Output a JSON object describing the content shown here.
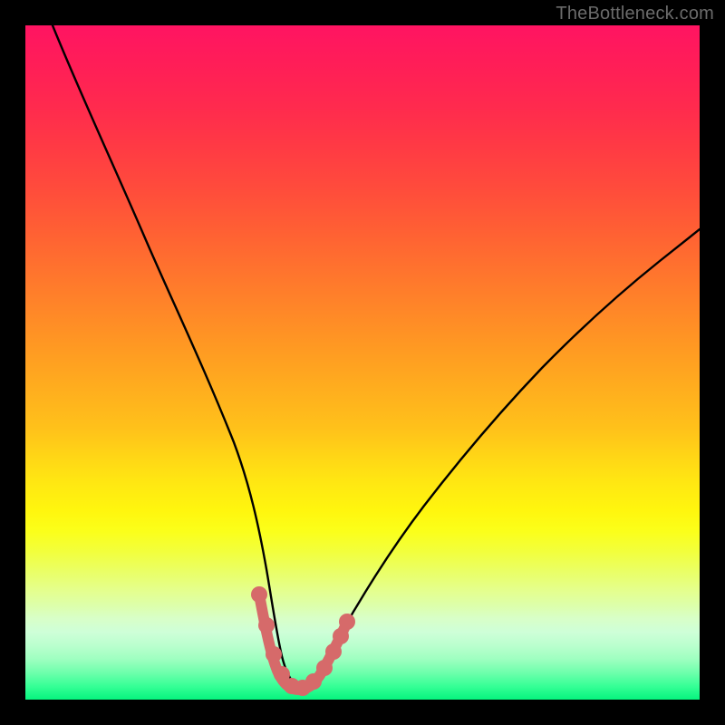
{
  "watermark": "TheBottleneck.com",
  "chart_data": {
    "type": "line",
    "title": "",
    "xlabel": "",
    "ylabel": "",
    "xlim": [
      0,
      100
    ],
    "ylim": [
      0,
      100
    ],
    "grid": false,
    "legend": false,
    "series": [
      {
        "name": "bottleneck-curve",
        "x": [
          4,
          8,
          12,
          16,
          20,
          24,
          28,
          32,
          33.5,
          35,
          36.5,
          38,
          39.5,
          41,
          42.5,
          44,
          47,
          50,
          55,
          60,
          65,
          70,
          75,
          80,
          85,
          90,
          95,
          100
        ],
        "y": [
          100,
          90,
          80,
          69,
          58,
          46,
          34,
          21,
          16,
          11,
          7,
          4,
          2.5,
          2,
          2.5,
          4,
          8,
          13,
          20,
          27,
          33,
          39,
          44,
          49,
          54,
          58,
          62,
          66
        ],
        "color": "#000000"
      },
      {
        "name": "highlight-dots",
        "type": "scatter",
        "x": [
          33.5,
          35,
          36.5,
          38,
          39.5,
          41,
          42.5,
          44,
          45.2,
          46.3,
          47.2
        ],
        "y": [
          16,
          11,
          7,
          4,
          2.5,
          2,
          2.5,
          4,
          6.3,
          8.4,
          10.5
        ],
        "color": "#d66a6a"
      }
    ],
    "annotations": []
  }
}
